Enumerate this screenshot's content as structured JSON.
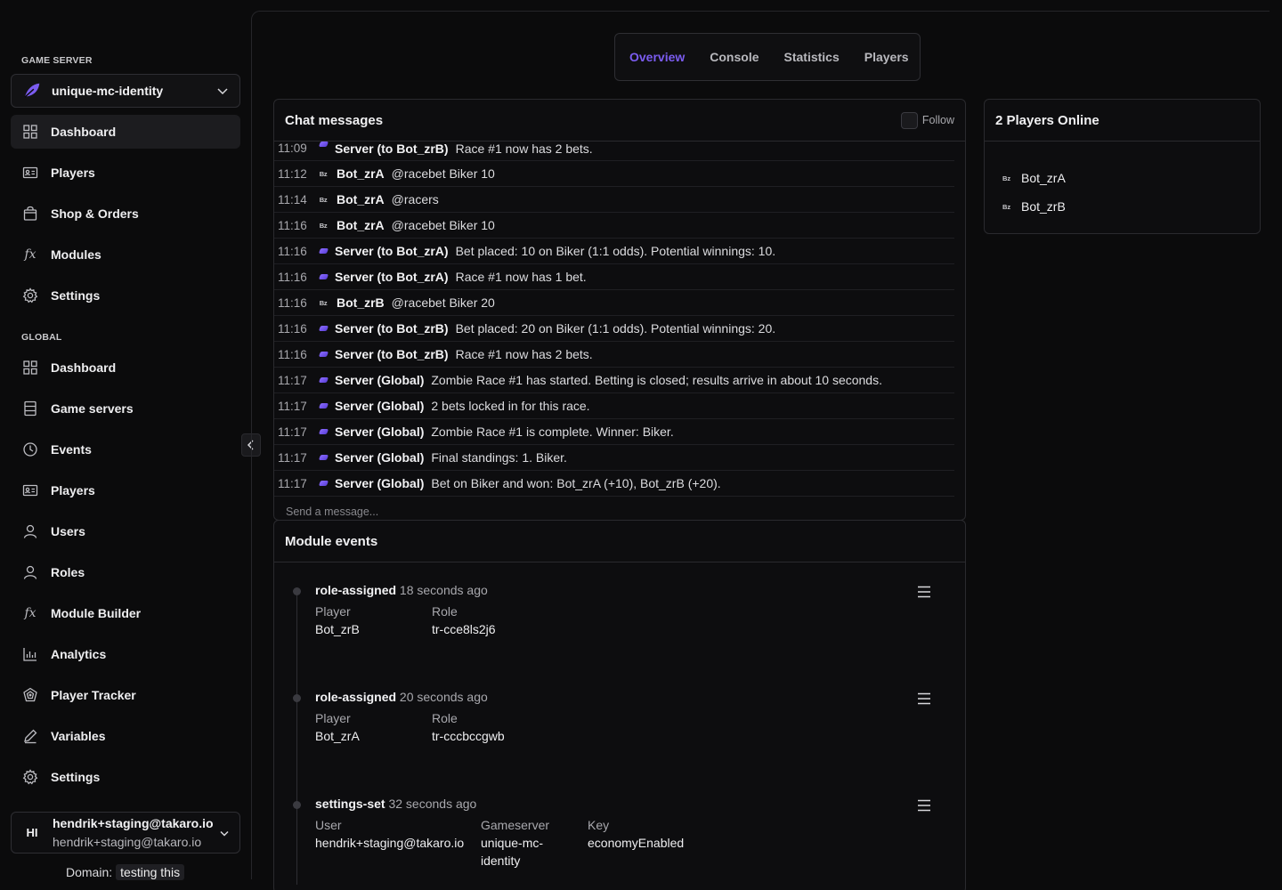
{
  "sidebar": {
    "game_server_label": "GAME SERVER",
    "server_name": "unique-mc-identity",
    "server_items": [
      {
        "label": "Dashboard"
      },
      {
        "label": "Players"
      },
      {
        "label": "Shop & Orders"
      },
      {
        "label": "Modules"
      },
      {
        "label": "Settings"
      }
    ],
    "global_label": "GLOBAL",
    "global_items": [
      {
        "label": "Dashboard"
      },
      {
        "label": "Game servers"
      },
      {
        "label": "Events"
      },
      {
        "label": "Players"
      },
      {
        "label": "Users"
      },
      {
        "label": "Roles"
      },
      {
        "label": "Module Builder"
      },
      {
        "label": "Analytics"
      },
      {
        "label": "Player Tracker"
      },
      {
        "label": "Variables"
      },
      {
        "label": "Settings"
      }
    ],
    "user": {
      "initials": "HI",
      "name": "hendrik+staging@takaro.io",
      "email": "hendrik+staging@takaro.io"
    },
    "domain_label": "Domain:",
    "domain_value": "testing this"
  },
  "tabs": [
    {
      "label": "Overview",
      "active": true
    },
    {
      "label": "Console"
    },
    {
      "label": "Statistics"
    },
    {
      "label": "Players"
    }
  ],
  "chat": {
    "title": "Chat messages",
    "follow_label": "Follow",
    "placeholder": "Send a message...",
    "messages": [
      {
        "time": "11:09",
        "type": "server",
        "who": "Server (to Bot_zrB)",
        "text": "Race #1 now has 2 bets."
      },
      {
        "time": "11:12",
        "type": "bot",
        "icon": "Bz",
        "who": "Bot_zrA",
        "text": "@racebet Biker 10"
      },
      {
        "time": "11:14",
        "type": "bot",
        "icon": "Bz",
        "who": "Bot_zrA",
        "text": "@racers"
      },
      {
        "time": "11:16",
        "type": "bot",
        "icon": "Bz",
        "who": "Bot_zrA",
        "text": "@racebet Biker 10"
      },
      {
        "time": "11:16",
        "type": "server",
        "who": "Server (to Bot_zrA)",
        "text": "Bet placed: 10 on Biker (1:1 odds). Potential winnings: 10."
      },
      {
        "time": "11:16",
        "type": "server",
        "who": "Server (to Bot_zrA)",
        "text": "Race #1 now has 1 bet."
      },
      {
        "time": "11:16",
        "type": "bot",
        "icon": "Bz",
        "who": "Bot_zrB",
        "text": "@racebet Biker 20"
      },
      {
        "time": "11:16",
        "type": "server",
        "who": "Server (to Bot_zrB)",
        "text": "Bet placed: 20 on Biker (1:1 odds). Potential winnings: 20."
      },
      {
        "time": "11:16",
        "type": "server",
        "who": "Server (to Bot_zrB)",
        "text": "Race #1 now has 2 bets."
      },
      {
        "time": "11:17",
        "type": "server",
        "who": "Server (Global)",
        "text": "Zombie Race #1 has started. Betting is closed; results arrive in about 10 seconds."
      },
      {
        "time": "11:17",
        "type": "server",
        "who": "Server (Global)",
        "text": "2 bets locked in for this race."
      },
      {
        "time": "11:17",
        "type": "server",
        "who": "Server (Global)",
        "text": "Zombie Race #1 is complete. Winner: Biker."
      },
      {
        "time": "11:17",
        "type": "server",
        "who": "Server (Global)",
        "text": "Final standings: 1. Biker."
      },
      {
        "time": "11:17",
        "type": "server",
        "who": "Server (Global)",
        "text": "Bet on Biker and won: Bot_zrA (+10), Bot_zrB (+20)."
      }
    ]
  },
  "modules": {
    "title": "Module events",
    "events": [
      {
        "name": "role-assigned",
        "ago": "18 seconds ago",
        "fields": [
          {
            "k": "Player",
            "v": "Bot_zrB"
          },
          {
            "k": "Role",
            "v": "tr-cce8ls2j6"
          }
        ]
      },
      {
        "name": "role-assigned",
        "ago": "20 seconds ago",
        "fields": [
          {
            "k": "Player",
            "v": "Bot_zrA"
          },
          {
            "k": "Role",
            "v": "tr-cccbccgwb"
          }
        ]
      },
      {
        "name": "settings-set",
        "ago": "32 seconds ago",
        "fields": [
          {
            "k": "User",
            "v": "hendrik+staging@takaro.io"
          },
          {
            "k": "Gameserver",
            "v": "unique-mc-identity"
          },
          {
            "k": "Key",
            "v": "economyEnabled"
          }
        ]
      }
    ]
  },
  "players": {
    "title": "2 Players Online",
    "list": [
      {
        "icon": "Bz",
        "name": "Bot_zrA"
      },
      {
        "icon": "Bz",
        "name": "Bot_zrB"
      }
    ]
  },
  "colors": {
    "accent": "#7b5cf0",
    "background": "#0b0b0c"
  }
}
